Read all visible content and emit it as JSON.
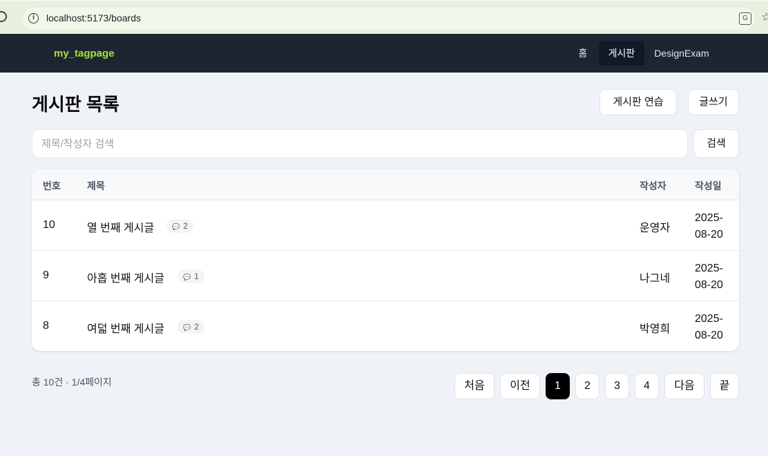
{
  "browser": {
    "url": "localhost:5173/boards"
  },
  "nav": {
    "brand": "my_tagpage",
    "items": [
      "홈",
      "게시판",
      "DesignExam"
    ],
    "active_index": 1
  },
  "header": {
    "title": "게시판 목록",
    "practice_label": "게시판 연습",
    "write_label": "글쓰기"
  },
  "search": {
    "placeholder": "제목/작성자 검색",
    "button_label": "검색"
  },
  "table": {
    "columns": [
      "번호",
      "제목",
      "작성자",
      "작성일"
    ],
    "rows": [
      {
        "num": "10",
        "title": "열 번째 게시글",
        "comments": "2",
        "author": "운영자",
        "date": "2025-08-20"
      },
      {
        "num": "9",
        "title": "아홉 번째 게시글",
        "comments": "1",
        "author": "나그네",
        "date": "2025-08-20"
      },
      {
        "num": "8",
        "title": "여덟 번째 게시글",
        "comments": "2",
        "author": "박영희",
        "date": "2025-08-20"
      }
    ]
  },
  "footer": {
    "summary": "총 10건 · 1/4페이지",
    "pagination": {
      "first": "처음",
      "prev": "이전",
      "pages": [
        "1",
        "2",
        "3",
        "4"
      ],
      "current": "1",
      "next": "다음",
      "last": "끝"
    }
  },
  "colors": {
    "nav_bg": "#1e2532",
    "brand": "#a3e635",
    "page_bg": "#eff3f8",
    "active_page": "#000000"
  },
  "icons": [
    "reload-icon",
    "info-icon",
    "translate-icon",
    "star-icon",
    "comment-icon"
  ]
}
